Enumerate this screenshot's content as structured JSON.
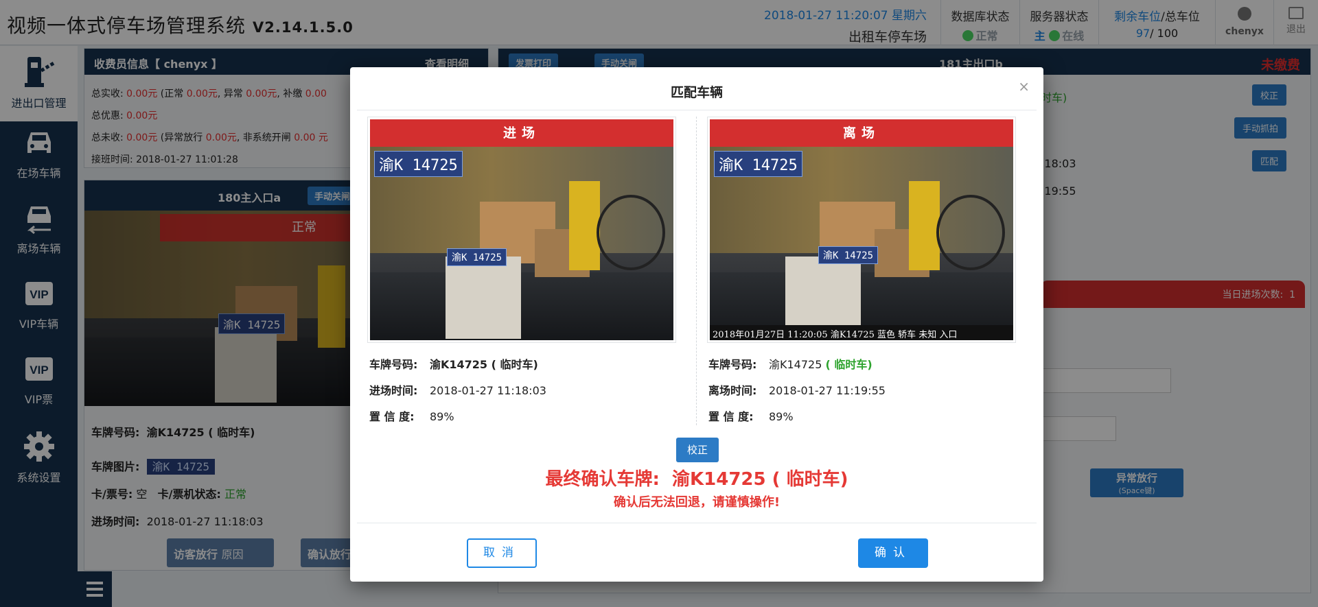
{
  "header": {
    "title": "视频一体式停车场管理系统",
    "version": "V2.14.1.5.0",
    "datetime": "2018-01-27 11:20:07 星期六",
    "lot_name": "出租车停车场",
    "db_status": {
      "label": "数据库状态",
      "value": "正常"
    },
    "server_status": {
      "label": "服务器状态",
      "role": "主",
      "value": "在线"
    },
    "spaces": {
      "label_remaining": "剩余车位",
      "label_total": "/总车位",
      "remaining": "97",
      "total": "/ 100"
    },
    "user": "chenyx",
    "logout": "退出"
  },
  "sidebar": {
    "items": [
      {
        "label": "进出口管理",
        "icon": "barrier-gate-icon"
      },
      {
        "label": "在场车辆",
        "icon": "car-front-icon"
      },
      {
        "label": "离场车辆",
        "icon": "car-exit-icon"
      },
      {
        "label": "VIP车辆",
        "icon": "vip-icon"
      },
      {
        "label": "VIP票",
        "icon": "vip-ticket-icon"
      },
      {
        "label": "系统设置",
        "icon": "gear-icon"
      }
    ]
  },
  "background": {
    "cashier_title": "收费员信息【 chenyx 】",
    "view_detail": "查看明细",
    "total_received_label": "总实收:",
    "total_received": "0.00元",
    "normal_label": "(正常",
    "normal": "0.00元",
    "abnormal_label": "异常",
    "abnormal": "0.00元",
    "supplement_label": "补缴",
    "supplement": "0.00",
    "discount_label": "总优惠:",
    "discount": "0.00元",
    "uncollected_label": "总未收:",
    "uncollected": "0.00元",
    "abnormal_release_label": "(异常放行",
    "abnormal_release": "0.00元",
    "non_system_label": "非系统开闸",
    "non_system": "0.00 元",
    "shift_time_label": "接班时间:",
    "shift_time": "2018-01-27 11:01:28",
    "entry_camera": "180主入口a",
    "manual_close": "手动关闸",
    "normal_banner": "正常",
    "plate_label": "车牌号码:",
    "plate": "渝K14725 ( 临时车)",
    "plate_image_label": "车牌图片:",
    "plate_image_text": "渝K 14725",
    "card_label": "卡/票号:",
    "card_value": "空",
    "card_status_label": "卡/票机状态:",
    "card_status": "正常",
    "entry_time_label": "进场时间:",
    "entry_time": "2018-01-27 11:18:03",
    "visitor_release": "访客放行",
    "reason": "原因",
    "confirm_release": "确认放行",
    "invoice_print": "发票打印",
    "manual_close2": "手动关闸",
    "exit_camera": "181主出口b",
    "unpaid": "未缴费",
    "right_tag": "时车)",
    "correct": "校正",
    "manual_capture": "手动抓拍",
    "match": "匹配",
    "time1": ":18:03",
    "time2": ":19:55",
    "daily_entries_label": "当日进场次数:",
    "daily_entries": "1",
    "abnormal_release_btn": "异常放行",
    "space_key": "(Space键)"
  },
  "modal": {
    "title": "匹配车辆",
    "entry": {
      "header": "进场",
      "plate_label": "车牌号码:",
      "plate": "渝K14725 ( 临时车)",
      "time_label": "进场时间:",
      "time": "2018-01-27 11:18:03",
      "confidence_label": "置 信 度:",
      "confidence": "89%",
      "image_plate_text": "渝K 14725",
      "image_plate_text2": "渝K 14725"
    },
    "exit": {
      "header": "离场",
      "plate_label": "车牌号码:",
      "plate": "渝K14725",
      "plate_type": "( 临时车)",
      "time_label": "离场时间:",
      "time": "2018-01-27 11:19:55",
      "confidence_label": "置 信 度:",
      "confidence": "89%",
      "image_plate_text": "渝K 14725",
      "image_plate_text2": "渝K 14725",
      "image_caption": "2018年01月27日 11:20:05 渝K14725 蓝色 轿车 未知 入口"
    },
    "correct_button": "校正",
    "final_label": "最终确认车牌:",
    "final_plate": "渝K14725 ( 临时车)",
    "warning": "确认后无法回退，请谨慎操作!",
    "cancel": "取消",
    "confirm": "确认"
  }
}
